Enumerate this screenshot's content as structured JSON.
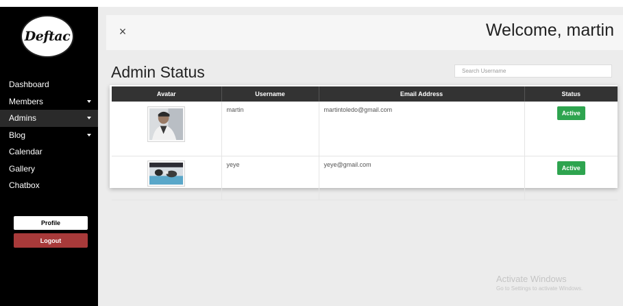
{
  "sidebar": {
    "logo_text": "Deftac",
    "items": [
      {
        "label": "Dashboard"
      },
      {
        "label": "Members"
      },
      {
        "label": "Admins"
      },
      {
        "label": "Blog"
      },
      {
        "label": "Calendar"
      },
      {
        "label": "Gallery"
      },
      {
        "label": "Chatbox"
      }
    ],
    "profile_label": "Profile",
    "logout_label": "Logout"
  },
  "header": {
    "close_icon": "×",
    "welcome": "Welcome, martin"
  },
  "main": {
    "title": "Admin Status",
    "search": {
      "placeholder": "Search Username"
    },
    "table": {
      "columns": [
        "Avatar",
        "Username",
        "Email Address",
        "Status"
      ],
      "rows": [
        {
          "username": "martin",
          "email": "martintoledo@gmail.com",
          "status": "Active"
        },
        {
          "username": "yeye",
          "email": "yeye@gmail.com",
          "status": "Active"
        }
      ]
    }
  },
  "overlay": {
    "line1": "Activate Windows",
    "line2": "Go to Settings to activate Windows."
  },
  "colors": {
    "sidebar_bg": "#000000",
    "logout_bg": "#a83a3a",
    "status_active": "#2ea44f",
    "table_header": "#333333"
  }
}
